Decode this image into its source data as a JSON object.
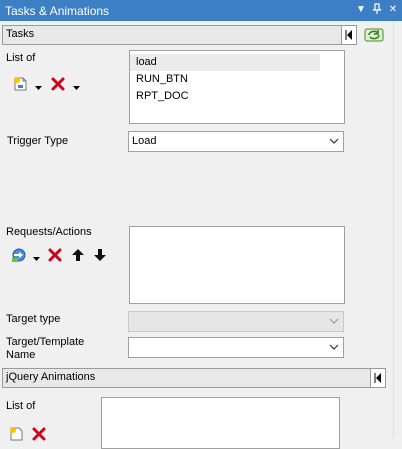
{
  "window": {
    "title": "Tasks & Animations"
  },
  "tasks_section": {
    "title": "Tasks",
    "list_of_label": "List of",
    "tasks": [
      "load",
      "RUN_BTN",
      "RPT_DOC"
    ],
    "selected_index": 0,
    "trigger_type_label": "Trigger Type",
    "trigger_type_value": "Load",
    "requests_actions_label": "Requests/Actions",
    "requests": [],
    "target_type_label": "Target type",
    "target_type_value": "",
    "target_template_label_line1": "Target/Template",
    "target_template_label_line2": "Name",
    "target_template_value": ""
  },
  "animations_section": {
    "title": "jQuery Animations",
    "list_of_label": "List of"
  },
  "colors": {
    "title_bar": "#3c7fc4",
    "panel_bg": "#f0f0f0",
    "delete_icon": "#d0021b"
  }
}
